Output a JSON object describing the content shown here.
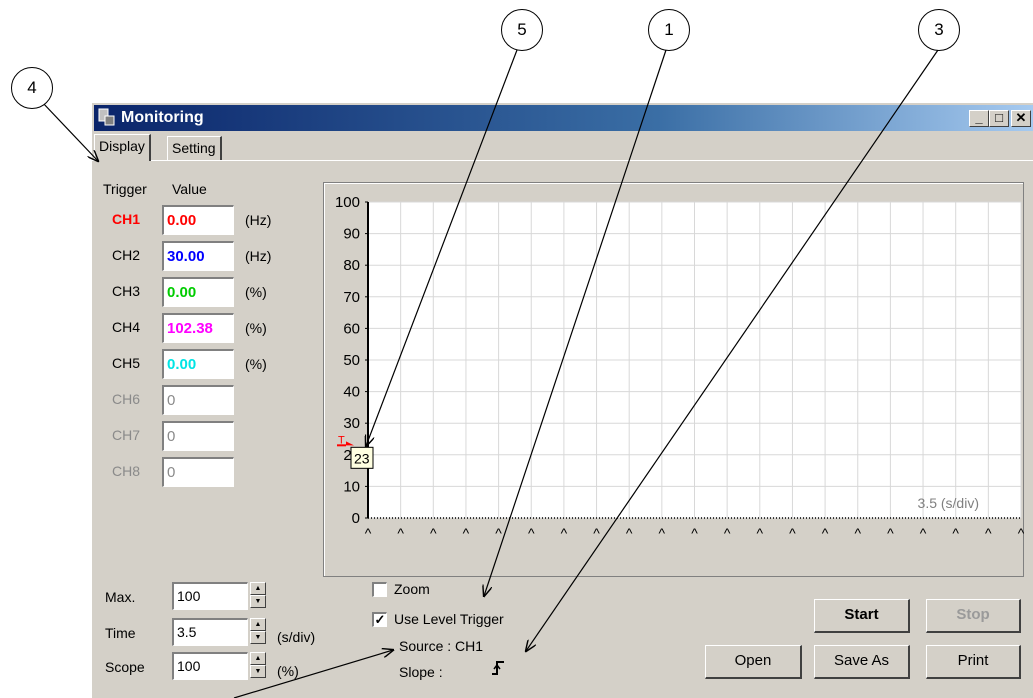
{
  "callouts": [
    {
      "id": "5",
      "text": "5"
    },
    {
      "id": "1",
      "text": "1"
    },
    {
      "id": "3",
      "text": "3"
    },
    {
      "id": "4",
      "text": "4"
    }
  ],
  "window": {
    "title": "Monitoring",
    "tabs": [
      {
        "label": "Display"
      },
      {
        "label": "Setting"
      }
    ],
    "caption_buttons": {
      "minimize": "_",
      "maximize": "□",
      "close": "✕"
    }
  },
  "channels": {
    "header_trigger": "Trigger",
    "header_value": "Value",
    "rows": [
      {
        "name": "CH1",
        "value": "0.00",
        "unit": "(Hz)",
        "color": "#ff0000",
        "enabled": true,
        "trigger": true
      },
      {
        "name": "CH2",
        "value": "30.00",
        "unit": "(Hz)",
        "color": "#0000ff",
        "enabled": true
      },
      {
        "name": "CH3",
        "value": "0.00",
        "unit": "(%)",
        "color": "#00cc00",
        "enabled": true
      },
      {
        "name": "CH4",
        "value": "102.38",
        "unit": "(%)",
        "color": "#ff00ff",
        "enabled": true
      },
      {
        "name": "CH5",
        "value": "0.00",
        "unit": "(%)",
        "color": "#00e5e5",
        "enabled": true
      },
      {
        "name": "CH6",
        "value": "0",
        "unit": "",
        "color": "#8a8a8a",
        "enabled": false
      },
      {
        "name": "CH7",
        "value": "0",
        "unit": "",
        "color": "#8a8a8a",
        "enabled": false
      },
      {
        "name": "CH8",
        "value": "0",
        "unit": "",
        "color": "#8a8a8a",
        "enabled": false
      }
    ]
  },
  "controls": {
    "max_label": "Max.",
    "max_value": "100",
    "time_label": "Time",
    "time_value": "3.5",
    "time_unit": "(s/div)",
    "scope_label": "Scope",
    "scope_value": "100",
    "scope_unit": "(%)"
  },
  "options": {
    "zoom_label": "Zoom",
    "zoom_checked": false,
    "level_trigger_label": "Use Level Trigger",
    "level_trigger_checked": true,
    "source_text": "Source : CH1",
    "slope_label": "Slope :"
  },
  "buttons": {
    "start": "Start",
    "stop": "Stop",
    "open": "Open",
    "save_as": "Save As",
    "print": "Print"
  },
  "chart_data": {
    "type": "line",
    "ylim": [
      0,
      100
    ],
    "y_ticks": [
      "0",
      "10",
      "20",
      "30",
      "40",
      "50",
      "60",
      "70",
      "80",
      "90",
      "100"
    ],
    "x_divisions": 20,
    "scale_text": "3.5 (s/div)",
    "trigger_marker": "T",
    "trigger_level": 23,
    "trigger_tooltip": "23",
    "grid": true,
    "series": []
  }
}
